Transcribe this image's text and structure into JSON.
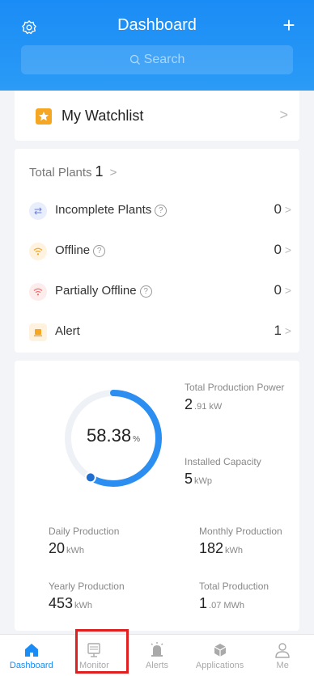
{
  "header": {
    "title": "Dashboard",
    "search_placeholder": "Search",
    "plus": "+"
  },
  "watchlist": {
    "label": "My Watchlist"
  },
  "plants": {
    "total_label": "Total Plants",
    "total_value": "1",
    "rows": [
      {
        "label": "Incomplete Plants",
        "value": "0",
        "icon_color": "#e8eefc",
        "icon_fg": "#6b7fd7"
      },
      {
        "label": "Offline",
        "value": "0",
        "icon_color": "#fff3e0",
        "icon_fg": "#f5a623"
      },
      {
        "label": "Partially Offline",
        "value": "0",
        "icon_color": "#fdecec",
        "icon_fg": "#f27070"
      },
      {
        "label": "Alert",
        "value": "1",
        "icon_color": "#fff3e0",
        "icon_fg": "#f5a623"
      }
    ]
  },
  "production": {
    "percent": "58.38",
    "percent_unit": "%",
    "percent_value": 58.38,
    "total_power_label": "Total Production Power",
    "total_power_value": "2",
    "total_power_unit": ".91 kW",
    "installed_label": "Installed Capacity",
    "installed_value": "5",
    "installed_unit": "kWp",
    "daily_label": "Daily Production",
    "daily_value": "20",
    "daily_unit": "kWh",
    "monthly_label": "Monthly Production",
    "monthly_value": "182",
    "monthly_unit": "kWh",
    "yearly_label": "Yearly Production",
    "yearly_value": "453",
    "yearly_unit": "kWh",
    "total_label": "Total Production",
    "total_value": "1",
    "total_unit": ".07 MWh"
  },
  "tabs": [
    {
      "label": "Dashboard",
      "icon": "home-icon",
      "active": true
    },
    {
      "label": "Monitor",
      "icon": "monitor-icon",
      "active": false
    },
    {
      "label": "Alerts",
      "icon": "alert-icon",
      "active": false
    },
    {
      "label": "Applications",
      "icon": "applications-icon",
      "active": false
    },
    {
      "label": "Me",
      "icon": "user-icon",
      "active": false
    }
  ],
  "colors": {
    "accent": "#1a8cf5",
    "highlight": "#e02020"
  }
}
